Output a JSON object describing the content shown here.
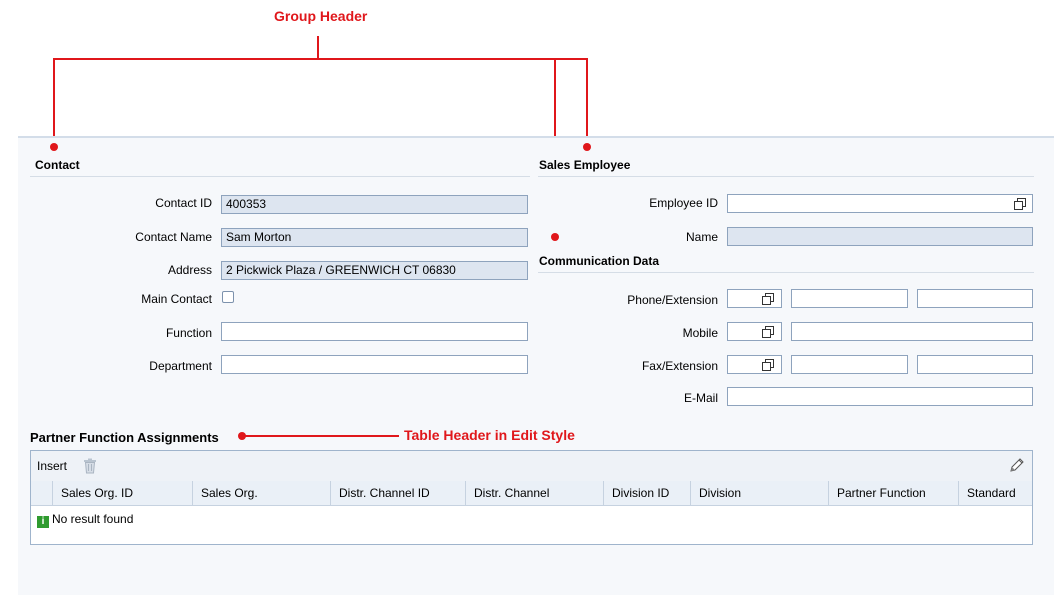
{
  "annotations": {
    "group_header": "Group Header",
    "table_header_edit": "Table Header in Edit Style"
  },
  "contact": {
    "title": "Contact",
    "fields": {
      "contact_id": {
        "label": "Contact ID",
        "value": "400353"
      },
      "contact_name": {
        "label": "Contact Name",
        "value": "Sam Morton"
      },
      "address": {
        "label": "Address",
        "value": "2 Pickwick Plaza / GREENWICH CT 06830"
      },
      "main_contact": {
        "label": "Main Contact",
        "checked": false
      },
      "function": {
        "label": "Function",
        "value": ""
      },
      "department": {
        "label": "Department",
        "value": ""
      }
    }
  },
  "sales_employee": {
    "title": "Sales Employee",
    "fields": {
      "employee_id": {
        "label": "Employee ID",
        "value": ""
      },
      "name": {
        "label": "Name",
        "value": ""
      }
    }
  },
  "communication": {
    "title": "Communication Data",
    "fields": {
      "phone": {
        "label": "Phone/Extension"
      },
      "mobile": {
        "label": "Mobile"
      },
      "fax": {
        "label": "Fax/Extension"
      },
      "email": {
        "label": "E-Mail",
        "value": ""
      }
    }
  },
  "partner_table": {
    "title": "Partner Function Assignments",
    "toolbar": {
      "insert_label": "Insert"
    },
    "columns": [
      "Sales Org. ID",
      "Sales Org.",
      "Distr. Channel ID",
      "Distr. Channel",
      "Division ID",
      "Division",
      "Partner Function",
      "Standard"
    ],
    "empty_message": "No result found"
  },
  "icons": [
    "copy-icon",
    "trash-icon",
    "pencil-icon",
    "info-icon"
  ],
  "colors": {
    "annotation": "#e0171b",
    "readonly_field": "#dde5f0",
    "field_border": "#8ea3bd"
  }
}
